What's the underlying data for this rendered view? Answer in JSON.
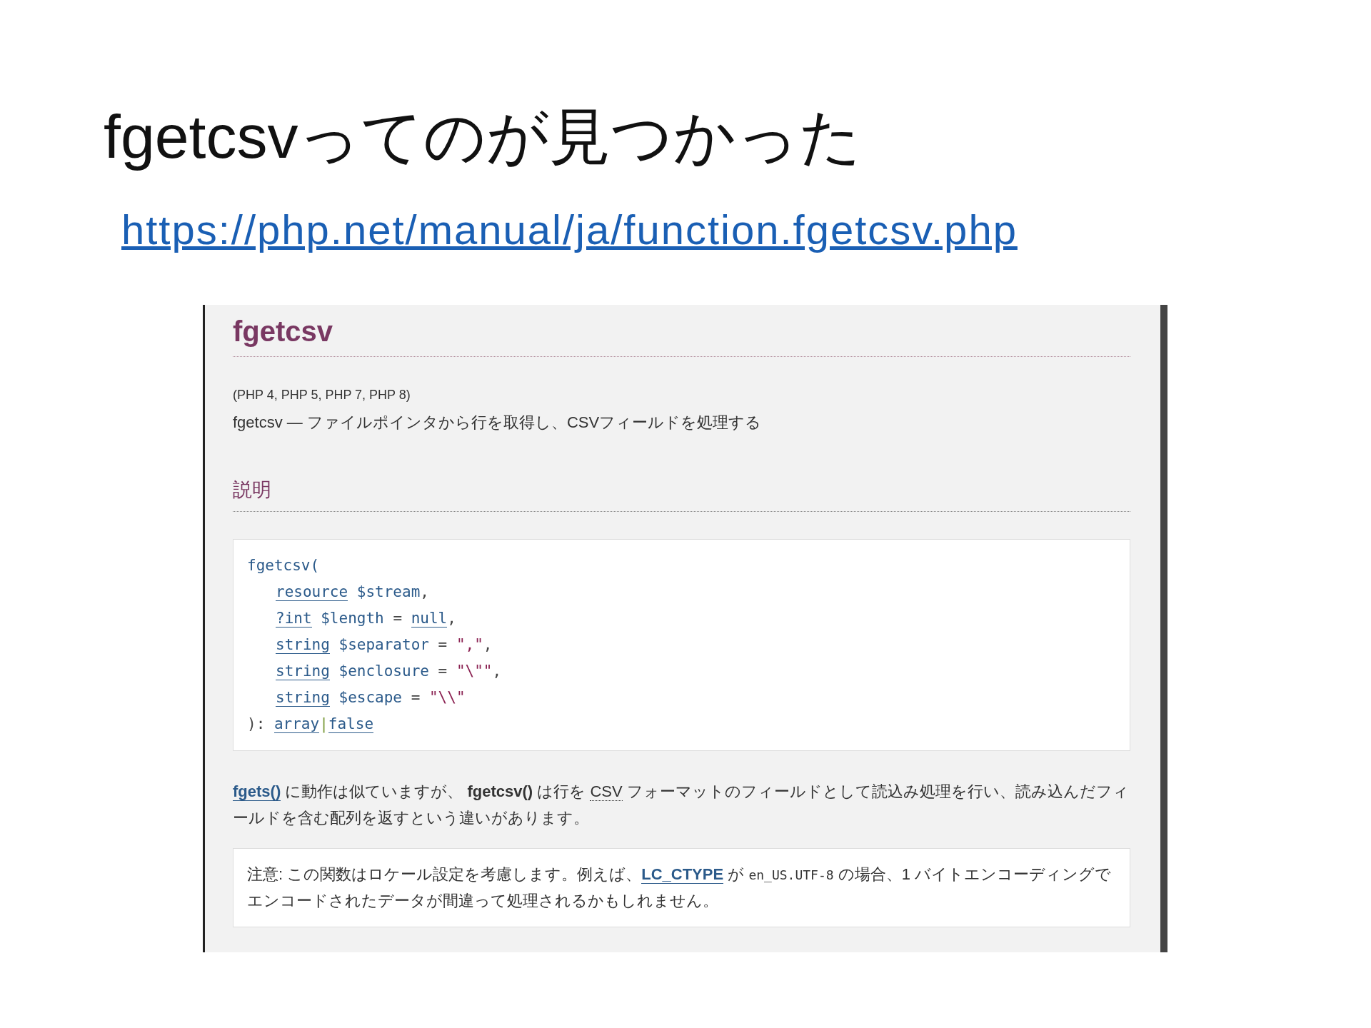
{
  "slide": {
    "title": "fgetcsvってのが見つかった",
    "link": "https://php.net/manual/ja/function.fgetcsv.php"
  },
  "page": {
    "title": "fgetcsv",
    "versions": "(PHP 4, PHP 5, PHP 7, PHP 8)",
    "summary": "fgetcsv — ファイルポインタから行を取得し、CSVフィールドを処理する",
    "section": "説明",
    "code": [
      [
        {
          "kind": "func",
          "text": "fgetcsv("
        }
      ],
      [
        {
          "kind": "type",
          "text": "resource"
        },
        {
          "kind": "var",
          "text": " $stream"
        },
        {
          "kind": "plain",
          "text": ","
        }
      ],
      [
        {
          "kind": "type",
          "text": "?int"
        },
        {
          "kind": "var",
          "text": " $length"
        },
        {
          "kind": "plain",
          "text": " = "
        },
        {
          "kind": "type",
          "text": "null"
        },
        {
          "kind": "plain",
          "text": ","
        }
      ],
      [
        {
          "kind": "type",
          "text": "string"
        },
        {
          "kind": "var",
          "text": " $separator"
        },
        {
          "kind": "plain",
          "text": " = "
        },
        {
          "kind": "string",
          "text": "\",\""
        },
        {
          "kind": "plain",
          "text": ","
        }
      ],
      [
        {
          "kind": "type",
          "text": "string"
        },
        {
          "kind": "var",
          "text": " $enclosure"
        },
        {
          "kind": "plain",
          "text": " = "
        },
        {
          "kind": "string",
          "text": "\"\\\"\""
        },
        {
          "kind": "plain",
          "text": ","
        }
      ],
      [
        {
          "kind": "type",
          "text": "string"
        },
        {
          "kind": "var",
          "text": " $escape"
        },
        {
          "kind": "plain",
          "text": " = "
        },
        {
          "kind": "string",
          "text": "\"\\\\\""
        }
      ],
      [
        {
          "kind": "plain",
          "text": "): "
        },
        {
          "kind": "type",
          "text": "array"
        },
        {
          "kind": "bar",
          "text": "|"
        },
        {
          "kind": "type",
          "text": "false"
        }
      ]
    ],
    "paragraph": [
      {
        "kind": "link",
        "text": "fgets()"
      },
      {
        "kind": "text",
        "text": " に動作は似ていますが、 "
      },
      {
        "kind": "bold",
        "text": "fgetcsv()"
      },
      {
        "kind": "text",
        "text": " は行を "
      },
      {
        "kind": "abbr",
        "text": "CSV"
      },
      {
        "kind": "text",
        "text": " フォーマットのフィールドとして読込み処理を行い、読み込んだフィールドを含む配列を返すという違いがあります。"
      }
    ],
    "note": [
      {
        "kind": "text",
        "text": "注意: この関数はロケール設定を考慮します。例えば、"
      },
      {
        "kind": "link",
        "text": "LC_CTYPE"
      },
      {
        "kind": "text",
        "text": " が "
      },
      {
        "kind": "code",
        "text": "en_US.UTF-8"
      },
      {
        "kind": "text",
        "text": " の場合、1 バイトエンコーディングでエンコードされたデータが間違って処理されるかもしれません。"
      }
    ]
  }
}
